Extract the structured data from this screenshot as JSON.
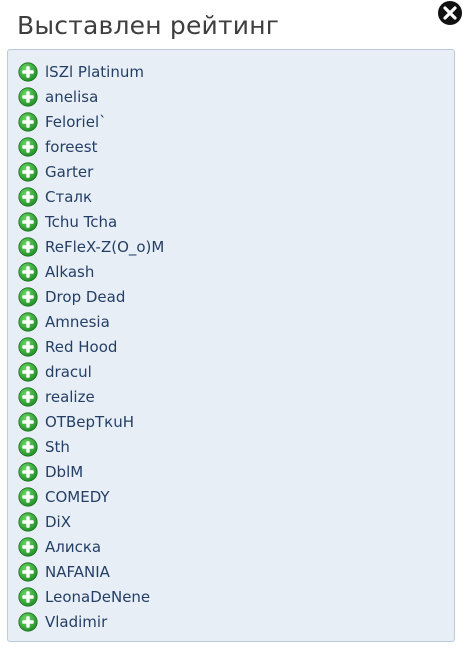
{
  "dialog": {
    "title": "Выставлен рейтинг",
    "close_icon": "close-icon"
  },
  "list": {
    "item_icon": "plus-circle-icon",
    "items": [
      {
        "name": "lSZl Platinum"
      },
      {
        "name": "anelisa"
      },
      {
        "name": "Feloriel`"
      },
      {
        "name": "foreest"
      },
      {
        "name": "Garter"
      },
      {
        "name": "Сталк"
      },
      {
        "name": "Tchu Tcha"
      },
      {
        "name": "ReFleX-Z(O_o)M"
      },
      {
        "name": "Alkash"
      },
      {
        "name": "Drop Dead"
      },
      {
        "name": "Amnesia"
      },
      {
        "name": "Red Hood"
      },
      {
        "name": "dracul"
      },
      {
        "name": "realize"
      },
      {
        "name": "ОТВерТкuН"
      },
      {
        "name": "Sth"
      },
      {
        "name": "DblM"
      },
      {
        "name": "COMEDY"
      },
      {
        "name": "DiX"
      },
      {
        "name": "Алиска"
      },
      {
        "name": "NAFANIA"
      },
      {
        "name": "LeonaDeNene"
      },
      {
        "name": "Vladimir"
      }
    ]
  },
  "colors": {
    "panel_background": "#e8eef5",
    "panel_border": "#bccbdb",
    "name_text": "#243f66",
    "title_text": "#3e3e3e",
    "plus_icon_green": "#2fa52f",
    "close_icon": "#111111"
  }
}
